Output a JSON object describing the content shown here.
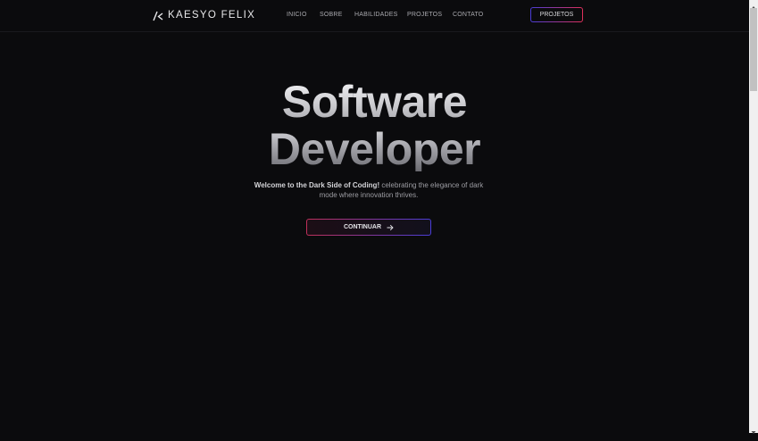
{
  "header": {
    "logo_text": "KAESYO FELIX",
    "nav": [
      {
        "label": "INICIO"
      },
      {
        "label": "SOBRE"
      },
      {
        "label": "HABILIDADES"
      },
      {
        "label": "PROJETOS"
      },
      {
        "label": "CONTATO"
      }
    ],
    "cta_label": "PROJETOS"
  },
  "hero": {
    "title_line1": "Software",
    "title_line2": "Developer",
    "subtitle_bold": "Welcome to the Dark Side of Coding!",
    "subtitle_rest": " celebrating the elegance of dark mode where innovation thrives.",
    "button_label": "CONTINUAR"
  },
  "colors": {
    "background": "#0b0b0d",
    "accent_pink": "#e0305a",
    "accent_indigo": "#4a3dd8"
  },
  "icons": {
    "logo": "kf-logo-icon",
    "button_arrow": "arrow-right-icon"
  }
}
